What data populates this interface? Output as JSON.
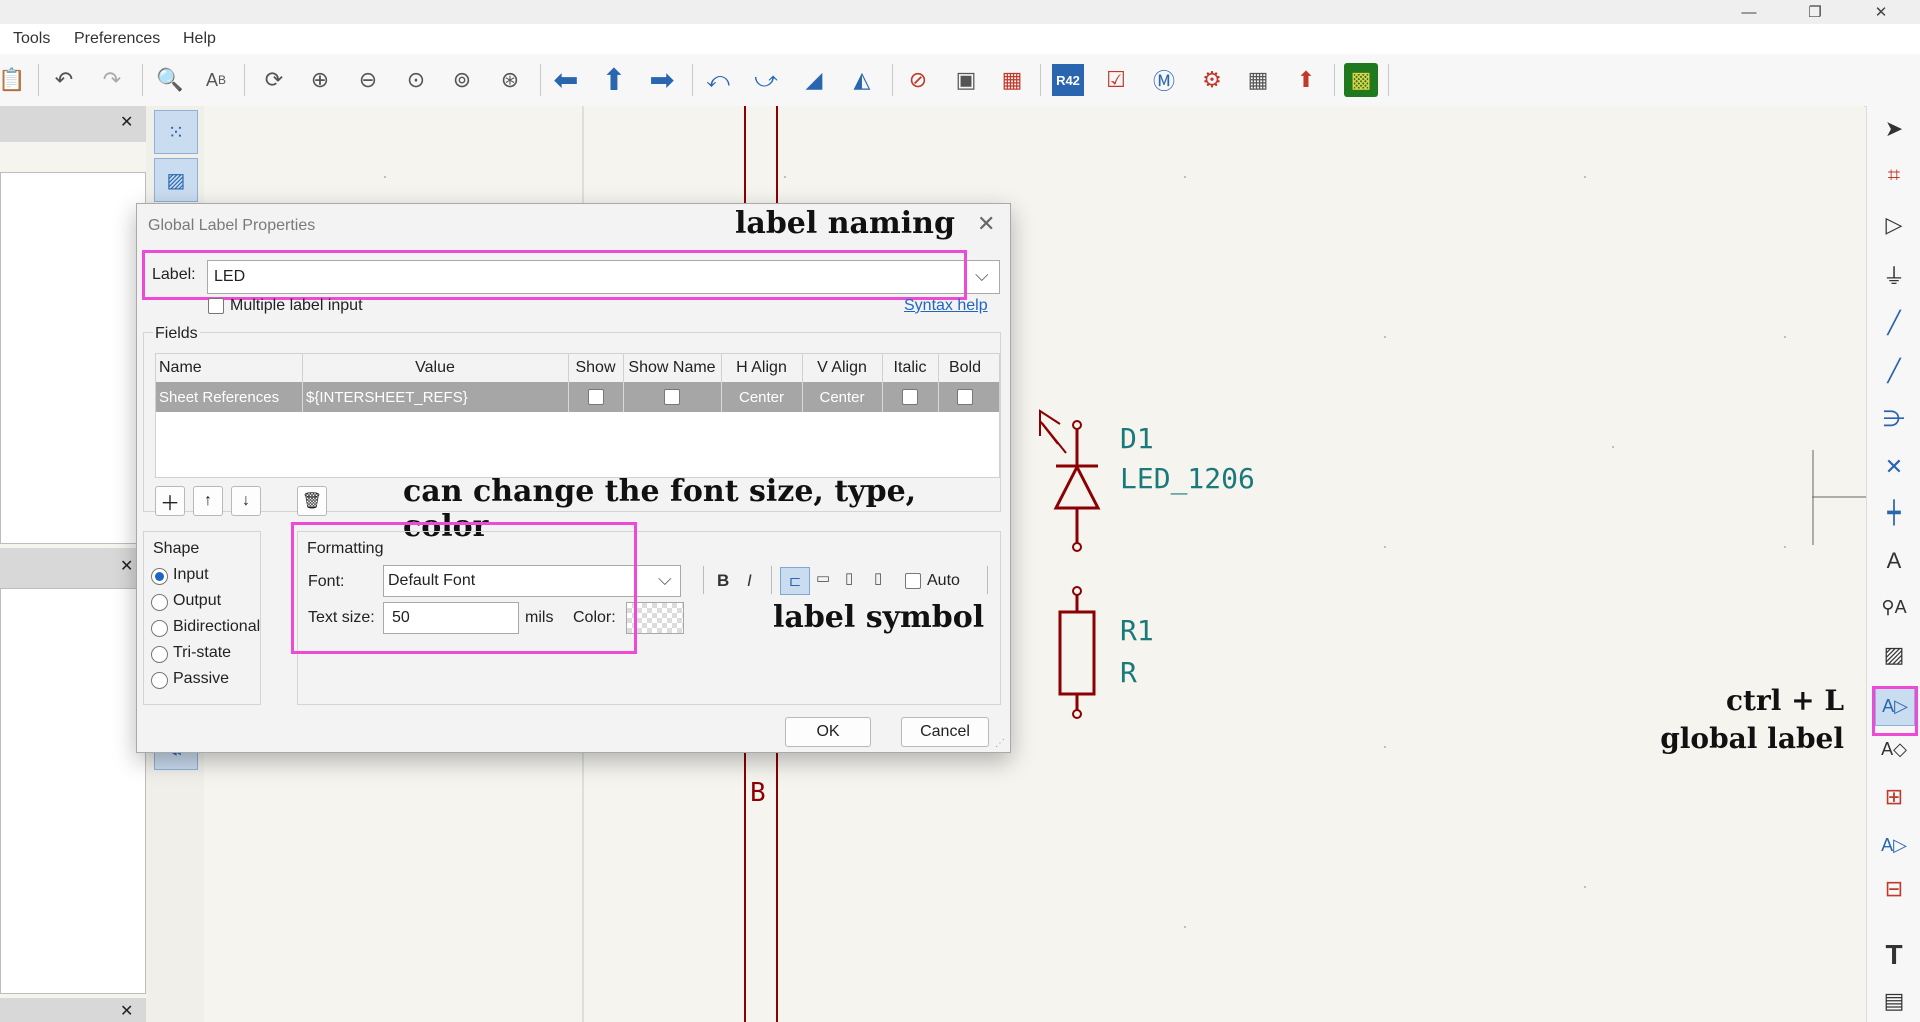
{
  "window": {
    "minimize": "—",
    "restore": "❐",
    "close": "✕"
  },
  "menu": {
    "items": [
      "Tools",
      "Preferences",
      "Help"
    ]
  },
  "toolbar": {
    "icons": [
      "paste-icon",
      "undo-icon",
      "redo-icon",
      "find-icon",
      "find-replace-icon",
      "refresh-icon",
      "zoom-in-icon",
      "zoom-out-icon",
      "zoom-fit-icon",
      "zoom-objects-icon",
      "zoom-selection-icon",
      "navigate-back-icon",
      "navigate-up-icon",
      "navigate-forward-icon",
      "rotate-ccw-icon",
      "rotate-cw-icon",
      "mirror-vertical-icon",
      "mirror-horizontal-icon",
      "symbol-editor-icon",
      "symbol-browser-icon",
      "annotate-icon",
      "erc-icon",
      "bom-icon",
      "simulator-icon",
      "footprint-assign-icon",
      "fields-editor-icon",
      "bom-export-icon",
      "pcb-editor-icon"
    ]
  },
  "dialog": {
    "title": "Global Label Properties",
    "label_caption": "Label:",
    "label_value": "LED",
    "multiple_label_input": "Multiple label input",
    "syntax_help": "Syntax help",
    "fields_caption": "Fields",
    "columns": [
      "Name",
      "Value",
      "Show",
      "Show Name",
      "H Align",
      "V Align",
      "Italic",
      "Bold"
    ],
    "rows": [
      {
        "name": "Sheet References",
        "value": "${INTERSHEET_REFS}",
        "h_align": "Center",
        "v_align": "Center"
      }
    ],
    "shape_caption": "Shape",
    "shapes": [
      "Input",
      "Output",
      "Bidirectional",
      "Tri-state",
      "Passive"
    ],
    "shape_selected": "Input",
    "formatting_caption": "Formatting",
    "font_caption": "Font:",
    "font_value": "Default Font",
    "text_size_caption": "Text size:",
    "text_size_value": "50",
    "text_size_unit": "mils",
    "color_caption": "Color:",
    "bold_glyph": "B",
    "italic_glyph": "I",
    "auto_label": "Auto",
    "ok": "OK",
    "cancel": "Cancel"
  },
  "annotations": {
    "label_naming": "label naming",
    "change_font": "can change the font size, type, color",
    "label_symbol": "label symbol",
    "shortcut": "ctrl + L",
    "global_label": "global label"
  },
  "schematic": {
    "d1_ref": "D1",
    "d1_value": "LED_1206",
    "r1_ref": "R1",
    "r1_value": "R",
    "wire_label": "B"
  },
  "colors": {
    "accent": "#ee4ad6",
    "wire": "#8b0000",
    "symbol_text": "#1a7a7a",
    "selection_row": "#a6a6a6"
  }
}
